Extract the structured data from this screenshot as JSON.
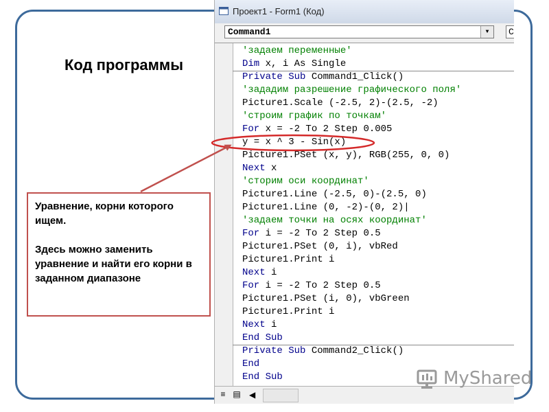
{
  "page": {
    "title": "Код программы"
  },
  "window": {
    "title": "Проект1 - Form1 (Код)"
  },
  "toolbar": {
    "object_value": "Command1",
    "procedure_value": "C"
  },
  "code_lines": [
    {
      "kw": "",
      "text": "'задаем переменные'",
      "type": "comment"
    },
    {
      "kw": "Dim",
      "text": " x, i As Single",
      "type": "code"
    },
    {
      "kw": "Private Sub",
      "text": " Command1_Click()",
      "type": "code"
    },
    {
      "kw": "",
      "text": "'зададим разрешение графического поля'",
      "type": "comment"
    },
    {
      "kw": "",
      "text": "Picture1.Scale (-2.5, 2)-(2.5, -2)",
      "type": "code"
    },
    {
      "kw": "",
      "text": "'строим график по точкам'",
      "type": "comment"
    },
    {
      "kw": "For",
      "text": " x = -2 To 2 Step 0.005",
      "type": "code"
    },
    {
      "kw": "",
      "text": "y = x ^ 3 - Sin(x)",
      "type": "code"
    },
    {
      "kw": "",
      "text": "Picture1.PSet (x, y), RGB(255, 0, 0)",
      "type": "code"
    },
    {
      "kw": "Next",
      "text": " x",
      "type": "code"
    },
    {
      "kw": "",
      "text": "'сторим оси координат'",
      "type": "comment"
    },
    {
      "kw": "",
      "text": "Picture1.Line (-2.5, 0)-(2.5, 0)",
      "type": "code"
    },
    {
      "kw": "",
      "text": "Picture1.Line (0, -2)-(0, 2)|",
      "type": "code"
    },
    {
      "kw": "",
      "text": "'задаем точки на осях координат'",
      "type": "comment"
    },
    {
      "kw": "For",
      "text": " i = -2 To 2 Step 0.5",
      "type": "code"
    },
    {
      "kw": "",
      "text": "Picture1.PSet (0, i), vbRed",
      "type": "code"
    },
    {
      "kw": "",
      "text": "Picture1.Print i",
      "type": "code"
    },
    {
      "kw": "Next",
      "text": " i",
      "type": "code"
    },
    {
      "kw": "For",
      "text": " i = -2 To 2 Step 0.5",
      "type": "code"
    },
    {
      "kw": "",
      "text": "Picture1.PSet (i, 0), vbGreen",
      "type": "code"
    },
    {
      "kw": "",
      "text": "Picture1.Print i",
      "type": "code"
    },
    {
      "kw": "Next",
      "text": " i",
      "type": "code"
    },
    {
      "kw": "End Sub",
      "text": "",
      "type": "code"
    },
    {
      "kw": "Private Sub",
      "text": " Command2_Click()",
      "type": "code"
    },
    {
      "kw": "End",
      "text": "",
      "type": "code"
    },
    {
      "kw": "End Sub",
      "text": "",
      "type": "code"
    }
  ],
  "callout": {
    "line1": "Уравнение, корни которого ищем.",
    "line2": "Здесь можно заменить уравнение и найти его корни в заданном диапазоне"
  },
  "watermark": {
    "text": "MyShared"
  },
  "colors": {
    "frame": "#3d6a9b",
    "annotation": "#c0504d",
    "keyword": "#00008b",
    "comment": "#008000"
  },
  "icons": [
    "form-window-icon",
    "chevron-down-icon",
    "procedure-view-icon",
    "full-module-view-icon",
    "scroll-left-icon",
    "myshared-logo-icon"
  ]
}
